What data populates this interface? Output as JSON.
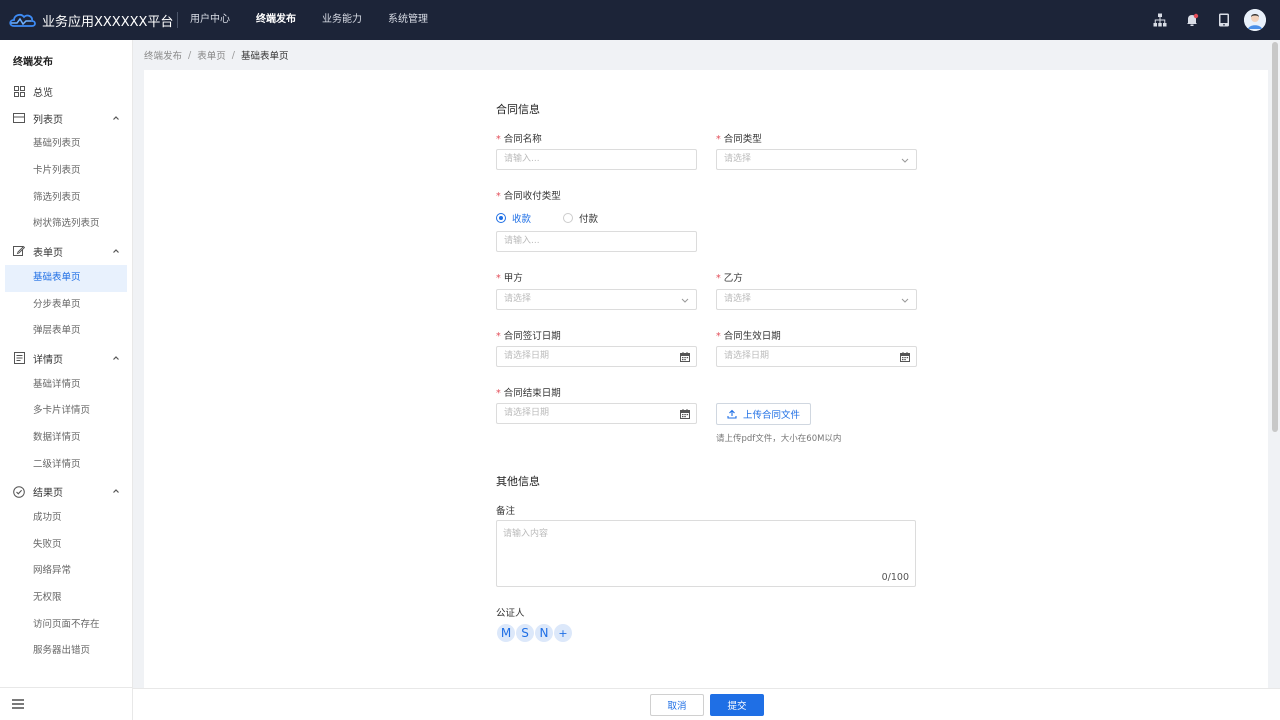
{
  "header": {
    "app_title": "业务应用XXXXXX平台",
    "nav": [
      {
        "label": "用户中心",
        "active": false
      },
      {
        "label": "终端发布",
        "active": true
      },
      {
        "label": "业务能力",
        "active": false
      },
      {
        "label": "系统管理",
        "active": false
      }
    ],
    "icons": [
      "sitemap-icon",
      "bell-icon",
      "device-icon",
      "user-avatar"
    ]
  },
  "sidebar": {
    "title": "终端发布",
    "overview": "总览",
    "groups": [
      {
        "label": "列表页",
        "icon": "list-page-icon",
        "items": [
          "基础列表页",
          "卡片列表页",
          "筛选列表页",
          "树状筛选列表页"
        ]
      },
      {
        "label": "表单页",
        "icon": "form-page-icon",
        "items": [
          "基础表单页",
          "分步表单页",
          "弹层表单页"
        ]
      },
      {
        "label": "详情页",
        "icon": "detail-page-icon",
        "items": [
          "基础详情页",
          "多卡片详情页",
          "数据详情页",
          "二级详情页"
        ]
      },
      {
        "label": "结果页",
        "icon": "result-page-icon",
        "items": [
          "成功页",
          "失败页",
          "网络异常",
          "无权限",
          "访问页面不存在",
          "服务器出错页"
        ]
      }
    ],
    "active_item": "基础表单页"
  },
  "breadcrumb": [
    "终端发布",
    "表单页",
    "基础表单页"
  ],
  "breadcrumb_sep": "/",
  "form": {
    "section1": "合同信息",
    "contract_name": {
      "label": "合同名称",
      "placeholder": "请输入..."
    },
    "contract_type": {
      "label": "合同类型",
      "placeholder": "请选择"
    },
    "payment_type": {
      "label": "合同收付类型",
      "options": [
        "收款",
        "付款"
      ],
      "selected": "收款",
      "placeholder": "请输入..."
    },
    "party_a": {
      "label": "甲方",
      "placeholder": "请选择"
    },
    "party_b": {
      "label": "乙方",
      "placeholder": "请选择"
    },
    "sign_date": {
      "label": "合同签订日期",
      "placeholder": "请选择日期"
    },
    "effective_date": {
      "label": "合同生效日期",
      "placeholder": "请选择日期"
    },
    "end_date": {
      "label": "合同结束日期",
      "placeholder": "请选择日期"
    },
    "upload": {
      "label": "上传合同文件",
      "hint": "请上传pdf文件，大小在60M以内"
    },
    "required_mark": "*",
    "section2": "其他信息",
    "remark": {
      "label": "备注",
      "placeholder": "请输入内容",
      "count": "0/100"
    },
    "notary": {
      "label": "公证人",
      "avatars": [
        "M",
        "S",
        "N"
      ],
      "add": "+"
    }
  },
  "footer": {
    "cancel": "取消",
    "submit": "提交"
  },
  "colors": {
    "primary": "#1f6fe5",
    "header_bg": "#1c2438",
    "required": "#e34d59"
  }
}
